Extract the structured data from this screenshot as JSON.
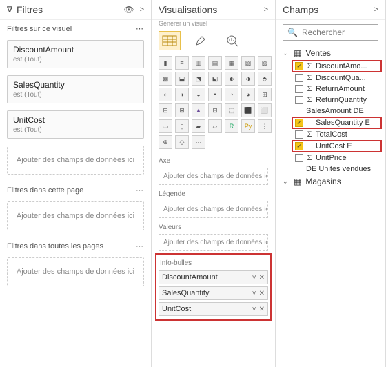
{
  "filters": {
    "title": "Filtres",
    "visual_section": "Filtres sur ce visuel",
    "page_section": "Filtres dans cette page",
    "all_section": "Filtres dans toutes les pages",
    "drop_hint": "Ajouter des champs de données ici",
    "is_all": "est (Tout)",
    "items": [
      {
        "name": "DiscountAmount"
      },
      {
        "name": "SalesQuantity"
      },
      {
        "name": "UnitCost"
      }
    ]
  },
  "viz": {
    "title": "Visualisations",
    "subtitle": "Générer un visuel",
    "wells": {
      "axe": "Axe",
      "legende": "Légende",
      "valeurs": "Valeurs",
      "infobulles": "Info-bulles"
    },
    "drop_hint": "Ajouter des champs de données ici",
    "tooltip_items": [
      {
        "name": "DiscountAmount"
      },
      {
        "name": "SalesQuantity"
      },
      {
        "name": "UnitCost"
      }
    ]
  },
  "fields": {
    "title": "Champs",
    "search_placeholder": "Rechercher",
    "tables": [
      {
        "name": "Ventes",
        "expanded": true,
        "items": [
          {
            "name": "DiscountAmo...",
            "checked": true,
            "sigma": true,
            "highlight": true
          },
          {
            "name": "DiscountQua...",
            "checked": false,
            "sigma": true,
            "highlight": false
          },
          {
            "name": "ReturnAmount",
            "checked": false,
            "sigma": true,
            "highlight": false
          },
          {
            "name": "ReturnQuantity",
            "checked": false,
            "sigma": true,
            "highlight": false
          }
        ],
        "plain_after_returns": "SalesAmount DE",
        "items2": [
          {
            "name": "SalesQuantity E",
            "checked": true,
            "sigma": false,
            "highlight": true
          },
          {
            "name": "TotalCost",
            "checked": false,
            "sigma": true,
            "highlight": false
          },
          {
            "name": "UnitCost E",
            "checked": true,
            "sigma": false,
            "highlight": true
          },
          {
            "name": "UnitPrice",
            "checked": false,
            "sigma": true,
            "highlight": false
          }
        ],
        "plain_after_unitprice": "DE Unités vendues"
      },
      {
        "name": "Magasins",
        "expanded": false
      }
    ]
  }
}
